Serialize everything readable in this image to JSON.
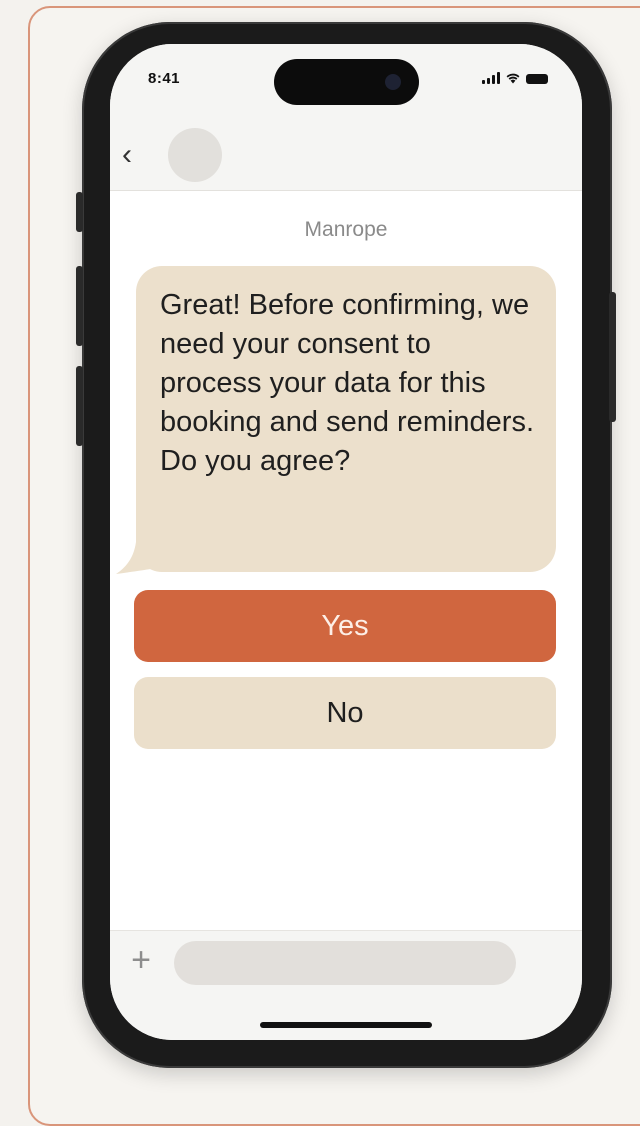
{
  "status_bar": {
    "time": "8:41",
    "signal_icon": "cellular-signal-icon",
    "wifi_icon": "wifi-icon",
    "battery_icon": "battery-icon"
  },
  "nav": {
    "back_icon": "chevron-left-icon",
    "avatar": "contact-avatar-placeholder"
  },
  "conversation": {
    "contact_name": "Manrope",
    "message": "Great! Before confirming, we need your consent to process your data for this booking and send reminders. Do you agree?"
  },
  "quick_replies": [
    {
      "label": "Yes",
      "color": "#d0663f"
    },
    {
      "label": "No",
      "color": "#ebdfcb"
    }
  ],
  "composer": {
    "add_icon": "plus-icon",
    "placeholder": ""
  },
  "colors": {
    "accent": "#d0663f",
    "bubble": "#ece0cc",
    "card_border": "#d9957a"
  }
}
